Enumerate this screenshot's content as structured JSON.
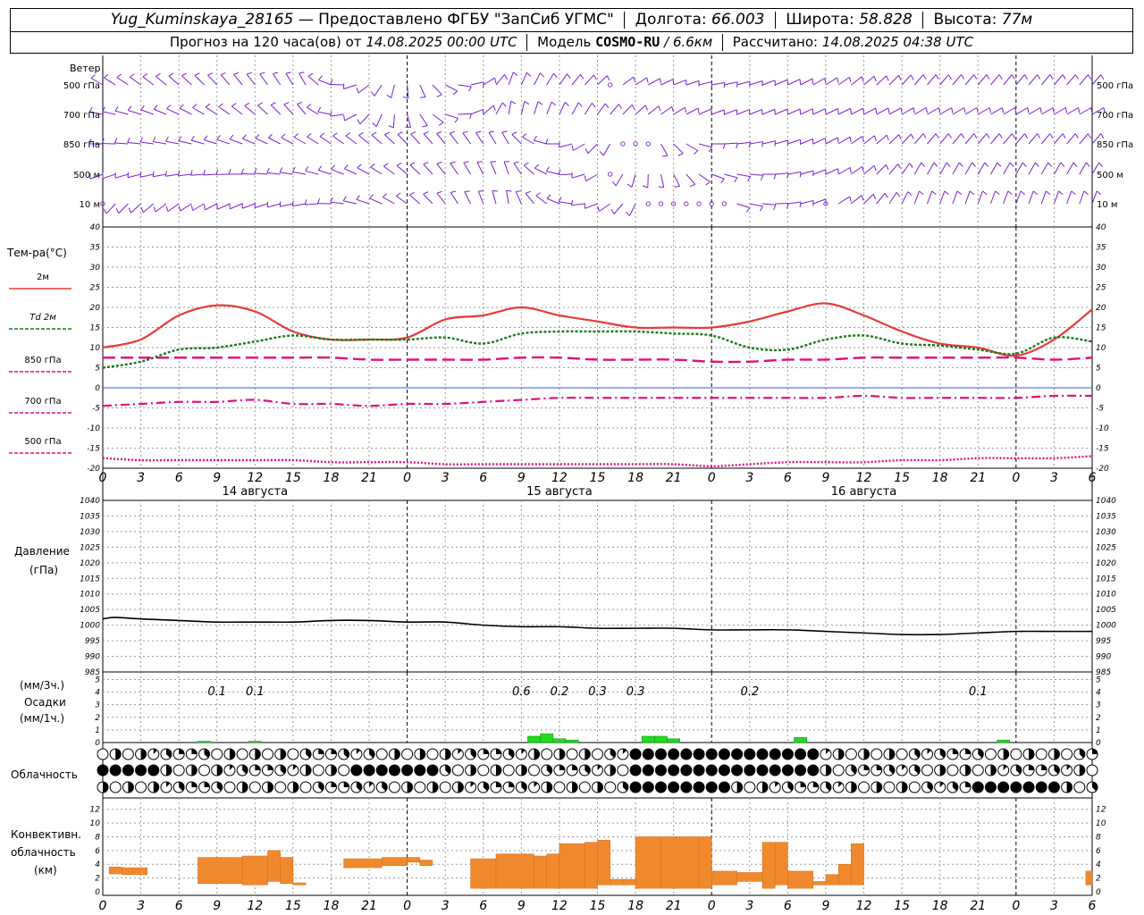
{
  "header": {
    "station": "Yug_Kuminskaya_28165",
    "provider": "— Предоставлено ФГБУ \"ЗапСиб УГМС\"",
    "lon_label": "Долгота:",
    "lon_value": "66.003",
    "lat_label": "Широта:",
    "lat_value": "58.828",
    "alt_label": "Высота:",
    "alt_value": "77м",
    "forecast_label": "Прогноз на 120 часа(ов) от",
    "forecast_start": "14.08.2025 00:00 UTC",
    "model_label": "Модель",
    "model_name": "COSMO-RU",
    "model_res": "/ 6.6км",
    "calc_label": "Рассчитано:",
    "calc_time": "14.08.2025 04:38 UTC"
  },
  "wind_panel": {
    "title": "Ветер",
    "levels": [
      "500 гПа",
      "700 гПа",
      "850 гПа",
      "500 м",
      "10  м"
    ],
    "color": "#7b1fd1"
  },
  "temp_panel": {
    "title": "Тем-ра(°С)",
    "legend": [
      {
        "label": "2м",
        "color": "#e53b3b",
        "style": "solid"
      },
      {
        "label": "Td  2м",
        "color": "#1a7a1a",
        "style": "dotted"
      },
      {
        "label": "850 гПа",
        "color": "#e0107a",
        "style": "dash"
      },
      {
        "label": "700 гПа",
        "color": "#e0107a",
        "style": "dashdot"
      },
      {
        "label": "500 гПа",
        "color": "#e0107a",
        "style": "dot"
      }
    ],
    "y_ticks": [
      "40",
      "35",
      "30",
      "25",
      "20",
      "15",
      "10",
      "5",
      "0",
      "-5",
      "-10",
      "-15",
      "-20"
    ]
  },
  "time_axis": {
    "hour_labels": [
      "0",
      "3",
      "6",
      "9",
      "12",
      "15",
      "18",
      "21",
      "0",
      "3",
      "6",
      "9",
      "12",
      "15",
      "18",
      "21",
      "0",
      "3",
      "6",
      "9",
      "12",
      "15",
      "18",
      "21",
      "0",
      "3",
      "6"
    ],
    "days": [
      "14 августа",
      "15 августа",
      "16 августа"
    ]
  },
  "pressure_panel": {
    "title": "Давление",
    "unit": "(гПа)",
    "y_ticks": [
      "1040",
      "1035",
      "1030",
      "1025",
      "1020",
      "1015",
      "1010",
      "1005",
      "1000",
      "995",
      "990",
      "985"
    ]
  },
  "precip_panel": {
    "unit_3h": "(мм/3ч.)",
    "title": "Осадки",
    "unit_1h": "(мм/1ч.)",
    "y_ticks": [
      "5",
      "4",
      "3",
      "2",
      "1",
      "0"
    ],
    "labels": [
      {
        "hour": 9,
        "text": "0.1"
      },
      {
        "hour": 12,
        "text": "0.1"
      },
      {
        "hour": 33,
        "text": "0.6"
      },
      {
        "hour": 36,
        "text": "0.2"
      },
      {
        "hour": 39,
        "text": "0.3"
      },
      {
        "hour": 42,
        "text": "0.3"
      },
      {
        "hour": 51,
        "text": "0.2"
      },
      {
        "hour": 69,
        "text": "0.1"
      }
    ]
  },
  "cloud_panel": {
    "title": "Облачность"
  },
  "conv_panel": {
    "title_1": "Конвективн.",
    "title_2": "облачность",
    "unit": "(км)",
    "y_ticks": [
      "12",
      "10",
      "8",
      "6",
      "4",
      "2",
      "0"
    ]
  },
  "chart_data": [
    {
      "type": "line",
      "title": "Тем-ра(°С)",
      "ylim": [
        -20,
        40
      ],
      "x_hours": [
        0,
        3,
        6,
        9,
        12,
        15,
        18,
        21,
        24,
        27,
        30,
        33,
        36,
        39,
        42,
        45,
        48,
        51,
        54,
        57,
        60,
        63,
        66,
        69,
        72,
        75,
        78
      ],
      "series": [
        {
          "name": "2м",
          "values": [
            10,
            12,
            18,
            20.5,
            19,
            14,
            12,
            12,
            12.5,
            17,
            18,
            20,
            18,
            16.5,
            15,
            15,
            15,
            16.5,
            19,
            21,
            18,
            14,
            11,
            10,
            8,
            12,
            19.5
          ]
        },
        {
          "name": "Td 2м",
          "values": [
            5,
            6.5,
            9.5,
            10,
            11.5,
            13,
            12,
            12,
            12,
            12.5,
            11,
            13.5,
            14,
            14,
            14,
            13.5,
            13,
            10,
            9.5,
            12,
            13,
            11,
            10.5,
            9.5,
            8.5,
            12.5,
            11.5
          ]
        },
        {
          "name": "850 гПа",
          "values": [
            7.5,
            7.5,
            7.5,
            7.5,
            7.5,
            7.5,
            7.5,
            7,
            7,
            7,
            7,
            7.5,
            7.5,
            7,
            7,
            7,
            6.5,
            6.5,
            7,
            7,
            7.5,
            7.5,
            7.5,
            7.5,
            7.5,
            7,
            7.5
          ]
        },
        {
          "name": "700 гПа",
          "values": [
            -4.5,
            -4,
            -3.5,
            -3.5,
            -3,
            -4,
            -4,
            -4.5,
            -4,
            -4,
            -3.5,
            -3,
            -2.5,
            -2.5,
            -2.5,
            -2.5,
            -2.5,
            -2.5,
            -2.5,
            -2.5,
            -2,
            -2.5,
            -2.5,
            -2.5,
            -2.5,
            -2,
            -2
          ]
        },
        {
          "name": "500 гПа",
          "values": [
            -17.5,
            -18,
            -18,
            -18,
            -18,
            -18,
            -18.5,
            -18.5,
            -18.5,
            -19,
            -19,
            -19,
            -19,
            -19,
            -19,
            -19,
            -19.5,
            -19,
            -18.5,
            -18.5,
            -18.5,
            -18,
            -18,
            -17.5,
            -17.5,
            -17.5,
            -17
          ]
        }
      ]
    },
    {
      "type": "line",
      "title": "Давление",
      "ylim": [
        985,
        1040
      ],
      "x_hours": [
        0,
        1,
        3,
        6,
        9,
        12,
        15,
        18,
        21,
        24,
        27,
        30,
        33,
        36,
        39,
        42,
        45,
        48,
        51,
        54,
        57,
        60,
        63,
        66,
        69,
        72,
        75,
        78
      ],
      "series": [
        {
          "values": [
            1002,
            1002.5,
            1002,
            1001.5,
            1001,
            1001,
            1001,
            1001.5,
            1001.5,
            1001,
            1001,
            1000,
            999.5,
            999.5,
            999,
            999,
            999,
            998.5,
            998.5,
            998.5,
            998,
            997.5,
            997,
            997,
            997.5,
            998,
            998,
            998
          ]
        }
      ]
    },
    {
      "type": "bar",
      "title": "Осадки",
      "ylim": [
        0,
        5
      ],
      "x_hours": [
        8,
        12,
        34,
        35,
        36,
        37,
        43,
        44,
        45,
        55,
        71
      ],
      "values": [
        0.1,
        0.1,
        0.5,
        0.7,
        0.3,
        0.2,
        0.5,
        0.5,
        0.3,
        0.4,
        0.2
      ]
    },
    {
      "type": "bar",
      "title": "Конвективн. облачность",
      "ylim": [
        0,
        13
      ],
      "bars": [
        [
          0.5,
          1.5,
          2.6,
          3.6
        ],
        [
          1.5,
          3.5,
          2.5,
          3.5
        ],
        [
          7.5,
          11,
          1.2,
          5
        ],
        [
          11,
          13,
          1,
          5.2
        ],
        [
          13,
          14,
          1.5,
          6
        ],
        [
          14,
          15,
          1.2,
          5
        ],
        [
          15,
          16,
          1,
          1.3
        ],
        [
          19,
          22,
          3.5,
          4.8
        ],
        [
          22,
          24,
          3.8,
          5
        ],
        [
          24,
          25,
          4.3,
          5
        ],
        [
          25,
          26,
          3.8,
          4.6
        ],
        [
          29,
          31,
          0.5,
          4.8
        ],
        [
          31,
          34,
          0.5,
          5.5
        ],
        [
          34,
          35,
          0.5,
          5.2
        ],
        [
          35,
          36,
          0.5,
          5.5
        ],
        [
          36,
          38,
          0.5,
          7
        ],
        [
          38,
          39,
          0.5,
          7.2
        ],
        [
          39,
          40,
          1,
          7.5
        ],
        [
          40,
          41,
          1,
          1.8
        ],
        [
          41,
          42,
          1,
          1.8
        ],
        [
          42,
          44,
          0.5,
          8
        ],
        [
          44,
          47,
          0.5,
          8
        ],
        [
          47,
          48,
          0.5,
          8
        ],
        [
          48,
          50,
          1,
          3
        ],
        [
          50,
          52,
          1.5,
          2.8
        ],
        [
          52,
          53,
          0.5,
          7.2
        ],
        [
          53,
          54,
          1,
          7.2
        ],
        [
          54,
          56,
          0.5,
          3
        ],
        [
          56,
          57,
          1,
          1.5
        ],
        [
          57,
          58,
          1,
          2.5
        ],
        [
          58,
          59,
          1,
          4
        ],
        [
          59,
          60,
          1,
          7
        ],
        [
          77.5,
          78,
          1,
          3
        ]
      ]
    }
  ]
}
